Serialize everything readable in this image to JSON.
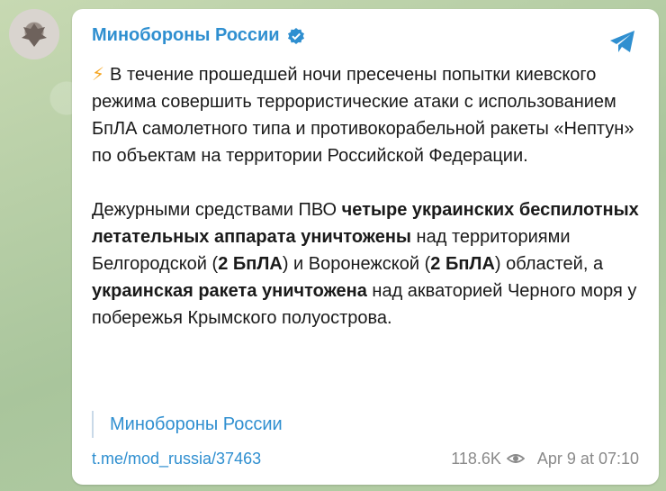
{
  "channel": {
    "name": "Минобороны России",
    "verified_icon": "verified-badge-icon",
    "accent": "#2f8fd0"
  },
  "post": {
    "bolt_icon": "⚡",
    "p1": "В течение прошедшей ночи пресечены попытки киевского режима совершить террористические атаки с использованием БпЛА самолетного типа и противокорабельной ракеты «Нептун» по объектам на территории Российской Федерации.",
    "p2_a": "Дежурными средствами ПВО ",
    "p2_b_bold": "четыре украинских беспилотных летательных аппарата уничтожены",
    "p2_c": " над территориями Белгородской (",
    "p2_d_bold": "2 БпЛА",
    "p2_e": ") и Воронежской (",
    "p2_f_bold": "2 БпЛА",
    "p2_g": ") областей, а ",
    "p2_h_bold": "украинская ракета уничтожена",
    "p2_i": " над акваторией Черного моря у побережья Крымского полуострова."
  },
  "signature": "Минобороны России",
  "link": "t.me/mod_russia/37463",
  "views": "118.6K",
  "date": "Apr 9 at 07:10"
}
